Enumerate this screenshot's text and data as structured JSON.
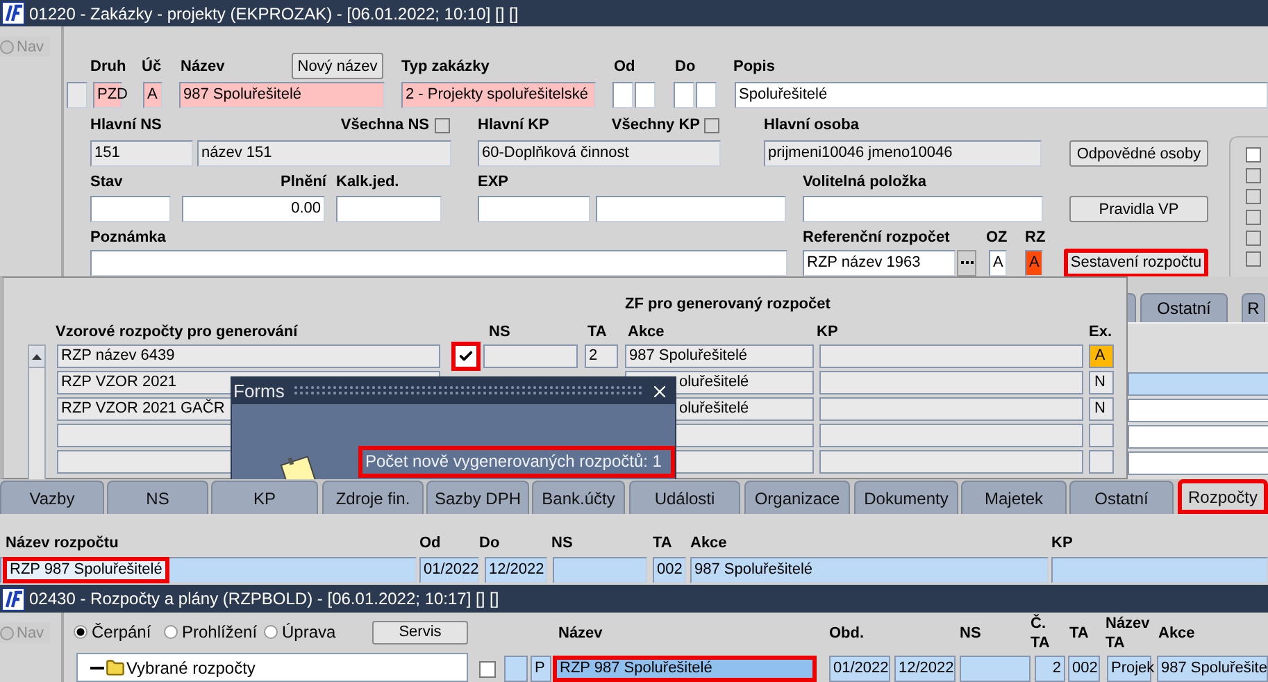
{
  "window": {
    "title": "01220 - Zakázky - projekty (EKPROZAK) - [06.01.2022; 10:10] [] []"
  },
  "nav": {
    "label": "Nav",
    "disabled": true
  },
  "form_rows": [
    [
      {
        "kind": "label",
        "text": "Druh"
      },
      {
        "kind": "label",
        "text": "Úč"
      },
      {
        "kind": "label",
        "text": "Název"
      },
      {
        "kind": "button",
        "text": "Nový název"
      },
      {
        "kind": "label",
        "text": "Typ zakázky"
      },
      {
        "kind": "label",
        "text": "Od"
      },
      {
        "kind": "label",
        "text": "Do"
      },
      {
        "kind": "label",
        "text": "Popis"
      }
    ],
    [
      {
        "kind": "field",
        "disabled": true
      },
      {
        "kind": "field",
        "value": "PZD",
        "required": true
      },
      {
        "kind": "field",
        "value": "A",
        "required": true
      },
      {
        "kind": "field",
        "value": "987 Spoluřešitelé",
        "required": true
      },
      {
        "kind": "field",
        "value": "2 - Projekty spoluřešitelské",
        "required": true
      },
      {
        "kind": "field"
      },
      {
        "kind": "field"
      },
      {
        "kind": "field"
      },
      {
        "kind": "field"
      },
      {
        "kind": "field",
        "value": "Spoluřešitelé"
      }
    ],
    [
      {
        "kind": "label",
        "text": "Hlavní NS"
      },
      {
        "kind": "label",
        "text": "Všechna NS"
      },
      {
        "kind": "checkbox",
        "checked": false
      },
      {
        "kind": "label",
        "text": "Hlavní KP"
      },
      {
        "kind": "label",
        "text": "Všechny KP"
      },
      {
        "kind": "checkbox",
        "checked": false
      },
      {
        "kind": "label",
        "text": "Hlavní osoba"
      }
    ],
    [
      {
        "kind": "field",
        "value": "151",
        "disabled": true
      },
      {
        "kind": "field",
        "value": "název 151",
        "disabled": true
      },
      {
        "kind": "field",
        "value": "60-Doplňková činnost",
        "disabled": true
      },
      {
        "kind": "field",
        "value": "prijmeni10046 jmeno10046",
        "disabled": true
      },
      {
        "kind": "button",
        "text": "Odpovědné osoby"
      }
    ],
    [
      {
        "kind": "label",
        "text": "Stav"
      },
      {
        "kind": "label",
        "text": "Plnění"
      },
      {
        "kind": "label",
        "text": "Kalk.jed."
      },
      {
        "kind": "label",
        "text": "EXP"
      },
      {
        "kind": "label",
        "text": "Volitelná položka"
      }
    ],
    [
      {
        "kind": "field"
      },
      {
        "kind": "field",
        "value": "0.00"
      },
      {
        "kind": "field"
      },
      {
        "kind": "field"
      },
      {
        "kind": "field"
      },
      {
        "kind": "field"
      },
      {
        "kind": "button",
        "text": "Pravidla VP"
      }
    ],
    [
      {
        "kind": "label",
        "text": "Poznámka"
      },
      {
        "kind": "label",
        "text": "Referenční rozpočet"
      },
      {
        "kind": "label",
        "text": "OZ"
      },
      {
        "kind": "label",
        "text": "RZ"
      }
    ],
    [
      {
        "kind": "field"
      },
      {
        "kind": "field",
        "value": "RZP název 1963"
      },
      {
        "kind": "lov"
      },
      {
        "kind": "field",
        "value": "A"
      },
      {
        "kind": "field",
        "value": "A",
        "highlighted": true
      },
      {
        "kind": "button",
        "text": "Sestavení rozpočtu",
        "marked": true
      }
    ]
  ],
  "side_checks": [
    {
      "disabled": false
    },
    {
      "disabled": true
    },
    {
      "disabled": true
    },
    {
      "disabled": true
    },
    {
      "disabled": true
    },
    {
      "disabled": true
    }
  ],
  "generator": {
    "title": "ZF pro generovaný rozpočet",
    "columns": [
      "Vzorové rozpočty pro generování",
      "NS",
      "TA",
      "Akce",
      "KP",
      "Ex."
    ],
    "rows": [
      {
        "name": "RZP název 6439",
        "checked": true,
        "marked": true,
        "ta": "2",
        "akce": "987 Spoluřešitelé",
        "ex": "A",
        "highlighted": true
      },
      {
        "name": "RZP VZOR 2021",
        "akce": "oluřešitelé",
        "overlapped": true,
        "ex": "N",
        "highlighted": false
      },
      {
        "name": "RZP VZOR 2021 GAČR",
        "akce": "oluřešitelé",
        "overlapped": true,
        "ex": "N",
        "highlighted": false
      },
      {},
      {}
    ]
  },
  "background_tabs": [
    {
      "label": "Ostatní"
    },
    {
      "label": "R"
    }
  ],
  "background_rows": [
    {
      "selected": true
    },
    {
      "selected": false
    },
    {
      "selected": false
    },
    {
      "selected": false
    }
  ],
  "dialog": {
    "title": "Forms",
    "message": "Počet nově vygenerovaných rozpočtů: 1",
    "marked": true
  },
  "tabs": [
    {
      "label": "Vazby",
      "selected": false
    },
    {
      "label": "NS",
      "selected": false
    },
    {
      "label": "KP",
      "selected": false
    },
    {
      "label": "Zdroje fin.",
      "selected": false
    },
    {
      "label": "Sazby DPH",
      "selected": false
    },
    {
      "label": "Bank.účty",
      "selected": false
    },
    {
      "label": "Události",
      "selected": false
    },
    {
      "label": "Organizace",
      "selected": false
    },
    {
      "label": "Dokumenty",
      "selected": false
    },
    {
      "label": "Majetek",
      "selected": false
    },
    {
      "label": "Ostatní",
      "selected": false
    },
    {
      "label": "Rozpočty",
      "selected": true,
      "marked": true
    }
  ],
  "budget": {
    "selected": true,
    "fields": [
      {
        "label": "Název rozpočtu",
        "value": "RZP 987 Spoluřešitelé",
        "marked": true
      },
      {
        "label": "Od",
        "value": "01/2022"
      },
      {
        "label": "Do",
        "value": "12/2022"
      },
      {
        "label": "NS"
      },
      {
        "label": "TA",
        "value": "002"
      },
      {
        "label": "Akce",
        "value": "987 Spoluřešitelé"
      },
      {
        "label": "KP"
      }
    ]
  },
  "window2": {
    "title": "02430 - Rozpočty a plány (RZPBOLD) - [06.01.2022; 10:17] [] []"
  },
  "nav2": {
    "label": "Nav",
    "disabled": true
  },
  "modes": [
    {
      "label": "Čerpání",
      "selected": true
    },
    {
      "label": "Prohlížení",
      "selected": false
    },
    {
      "label": "Úprava",
      "selected": false
    }
  ],
  "servis_button": "Servis",
  "tree": [
    {
      "label": "Vybrané rozpočty"
    }
  ],
  "list": {
    "columns": [
      "Název",
      "Obd.",
      "NS",
      "Č. TA",
      "TA",
      "Název TA",
      "Akce"
    ],
    "row": {
      "checked": false,
      "type": "P",
      "name": "RZP 987 Spoluřešitelé",
      "marked": true,
      "cells": [
        {
          "value": "01/2022"
        },
        {
          "value": "12/2022"
        },
        {},
        {
          "value": "2"
        },
        {
          "value": "002"
        },
        {
          "value": "Projek"
        },
        {
          "value": "987 Spoluřešite"
        }
      ]
    }
  }
}
